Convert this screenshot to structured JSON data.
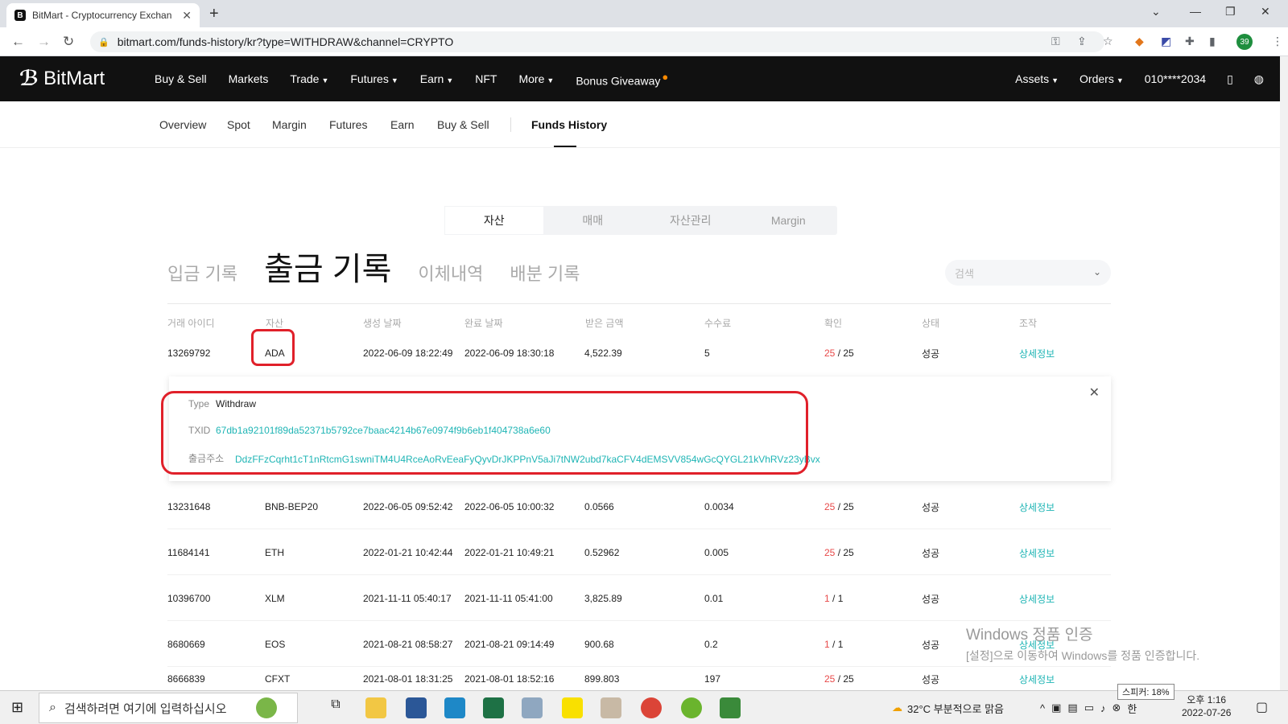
{
  "browser": {
    "tab_title": "BitMart - Cryptocurrency Exchan",
    "url": "bitmart.com/funds-history/kr?type=WITHDRAW&channel=CRYPTO",
    "profile_badge": "39"
  },
  "header": {
    "logo_text": "BitMart",
    "nav": [
      "Buy & Sell",
      "Markets",
      "Trade",
      "Futures",
      "Earn",
      "NFT",
      "More",
      "Bonus Giveaway"
    ],
    "right": {
      "assets": "Assets",
      "orders": "Orders",
      "account": "010****2034"
    }
  },
  "subnav": [
    "Overview",
    "Spot",
    "Margin",
    "Futures",
    "Earn",
    "Buy & Sell",
    "Funds History"
  ],
  "segment_tabs": [
    "자산",
    "매매",
    "자산관리",
    "Margin"
  ],
  "record_tabs": [
    "입금 기록",
    "출금 기록",
    "이체내역",
    "배분 기록"
  ],
  "search_placeholder": "검색",
  "table": {
    "headers": [
      "거래 아이디",
      "자산",
      "생성 날짜",
      "완료 날짜",
      "받은 금액",
      "수수료",
      "확인",
      "상태",
      "조작"
    ],
    "rows": [
      {
        "id": "13269792",
        "asset": "ADA",
        "created": "2022-06-09 18:22:49",
        "completed": "2022-06-09 18:30:18",
        "amount": "4,522.39",
        "fee": "5",
        "conf_a": "25",
        "conf_b": "/ 25",
        "status": "성공",
        "action": "상세정보"
      },
      {
        "id": "13231648",
        "asset": "BNB-BEP20",
        "created": "2022-06-05 09:52:42",
        "completed": "2022-06-05 10:00:32",
        "amount": "0.0566",
        "fee": "0.0034",
        "conf_a": "25",
        "conf_b": "/ 25",
        "status": "성공",
        "action": "상세정보"
      },
      {
        "id": "11684141",
        "asset": "ETH",
        "created": "2022-01-21 10:42:44",
        "completed": "2022-01-21 10:49:21",
        "amount": "0.52962",
        "fee": "0.005",
        "conf_a": "25",
        "conf_b": "/ 25",
        "status": "성공",
        "action": "상세정보"
      },
      {
        "id": "10396700",
        "asset": "XLM",
        "created": "2021-11-11 05:40:17",
        "completed": "2021-11-11 05:41:00",
        "amount": "3,825.89",
        "fee": "0.01",
        "conf_a": "1",
        "conf_b": "/ 1",
        "status": "성공",
        "action": "상세정보"
      },
      {
        "id": "8680669",
        "asset": "EOS",
        "created": "2021-08-21 08:58:27",
        "completed": "2021-08-21 09:14:49",
        "amount": "900.68",
        "fee": "0.2",
        "conf_a": "1",
        "conf_b": "/ 1",
        "status": "성공",
        "action": "상세정보"
      },
      {
        "id": "8666839",
        "asset": "CFXT",
        "created": "2021-08-01 18:31:25",
        "completed": "2021-08-01 18:52:16",
        "amount": "899.803",
        "fee": "197",
        "conf_a": "25",
        "conf_b": "/ 25",
        "status": "성공",
        "action": "상세정보"
      }
    ]
  },
  "detail": {
    "type_label": "Type",
    "type_value": "Withdraw",
    "txid_label": "TXID",
    "txid_value": "67db1a92101f89da52371b5792ce7baac4214b67e0974f9b6eb1f404738a6e60",
    "address_label": "출금주소",
    "address_value": "DdzFFzCqrht1cT1nRtcmG1swniTM4U4RceAoRvEeaFyQyvDrJKPPnV5aJi7tNW2ubd7kaCFV4dEMSVV854wGcQYGL21kVhRVz23yBvx"
  },
  "watermark": {
    "line1": "Windows 정품 인증",
    "line2": "[설정]으로 이동하여 Windows를 정품 인증합니다."
  },
  "taskbar": {
    "search_placeholder": "검색하려면 여기에 입력하십시오",
    "weather": "32°C  부분적으로 맑음",
    "ime": "한",
    "speaker_tooltip": "스피커: 18%",
    "time": "오후 1:16",
    "date": "2022-07-26"
  },
  "colors": {
    "accent": "#1fb5b5",
    "confirm_red": "#e84a4a",
    "highlight": "#e0202a",
    "header_bg": "#111111"
  }
}
